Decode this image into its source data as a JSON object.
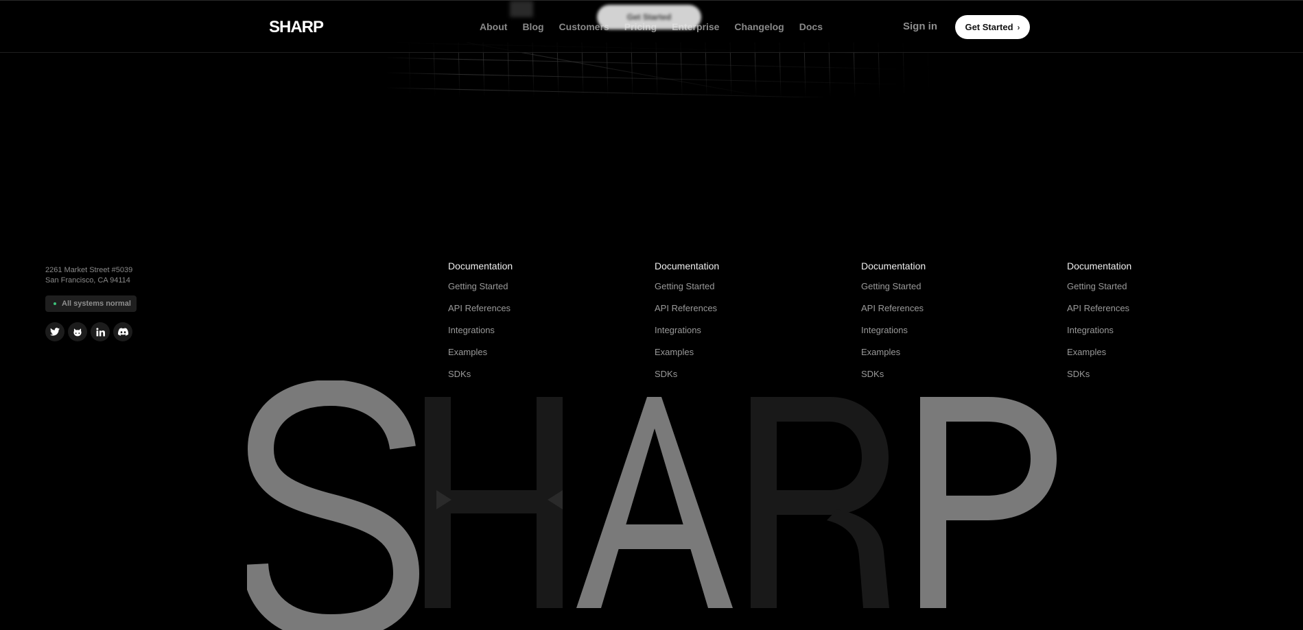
{
  "nav": {
    "logo": "SHARP",
    "links": [
      "About",
      "Blog",
      "Customers",
      "Pricing",
      "Enterprise",
      "Changelog",
      "Docs"
    ],
    "ghost_button_label": "Get Started",
    "sign_in": "Sign in",
    "get_started": "Get Started",
    "get_started_chevron": "›"
  },
  "footer": {
    "address_line1": "2261 Market Street #5039",
    "address_line2": "San Francisco, CA 94114",
    "status": "All systems normal",
    "status_color": "#3ec27a",
    "socials": [
      "twitter-icon",
      "github-icon",
      "linkedin-icon",
      "discord-icon"
    ],
    "columns": [
      {
        "title": "Documentation",
        "links": [
          "Getting Started",
          "API References",
          "Integrations",
          "Examples",
          "SDKs"
        ]
      },
      {
        "title": "Documentation",
        "links": [
          "Getting Started",
          "API References",
          "Integrations",
          "Examples",
          "SDKs"
        ]
      },
      {
        "title": "Documentation",
        "links": [
          "Getting Started",
          "API References",
          "Integrations",
          "Examples",
          "SDKs"
        ]
      },
      {
        "title": "Documentation",
        "links": [
          "Getting Started",
          "API References",
          "Integrations",
          "Examples",
          "SDKs"
        ]
      }
    ]
  },
  "wordmark": {
    "letters": [
      "S",
      "H",
      "A",
      "R",
      "P"
    ],
    "colors": {
      "light": "#7a7a7a",
      "dark": "#191919"
    }
  }
}
